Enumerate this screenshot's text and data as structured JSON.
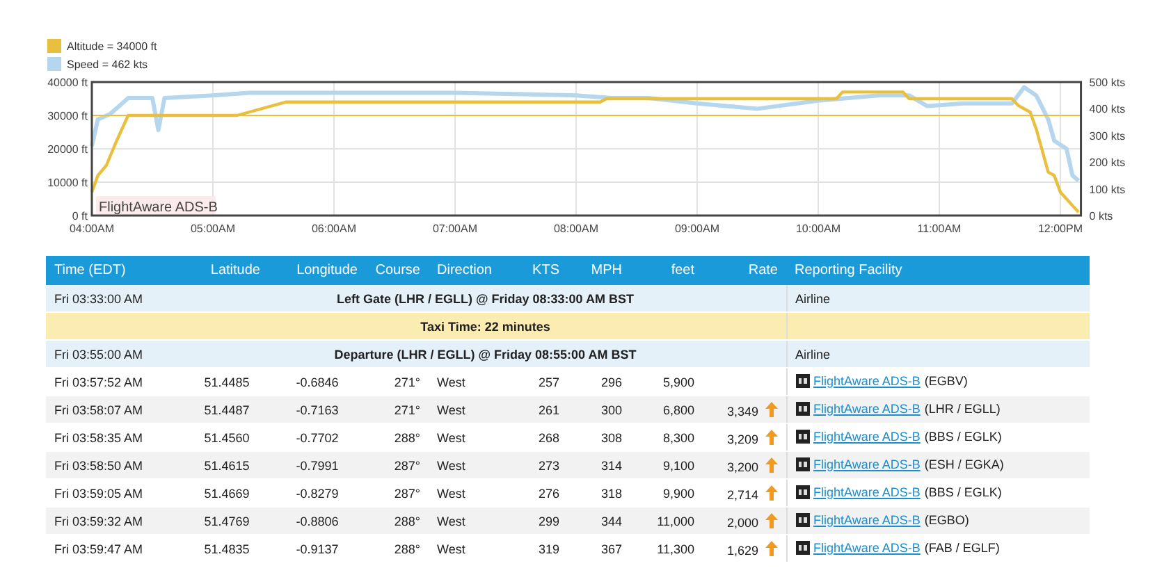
{
  "chart": {
    "legend": [
      {
        "label": "Altitude = 34000 ft",
        "color": "#e8bf3e"
      },
      {
        "label": "Speed = 462 kts",
        "color": "#b6d6ee"
      }
    ],
    "source_label": "FlightAware ADS-B",
    "chart_data": {
      "type": "line",
      "xlim": [
        4,
        12.17
      ],
      "ylim": [
        0,
        40000
      ],
      "y2lim": [
        0,
        500
      ],
      "xticks": [
        {
          "value": 4,
          "label": "04:00AM"
        },
        {
          "value": 5,
          "label": "05:00AM"
        },
        {
          "value": 6,
          "label": "06:00AM"
        },
        {
          "value": 7,
          "label": "07:00AM"
        },
        {
          "value": 8,
          "label": "08:00AM"
        },
        {
          "value": 9,
          "label": "09:00AM"
        },
        {
          "value": 10,
          "label": "10:00AM"
        },
        {
          "value": 11,
          "label": "11:00AM"
        },
        {
          "value": 12,
          "label": "12:00PM"
        }
      ],
      "yticks": [
        {
          "value": 0,
          "label": "0 ft"
        },
        {
          "value": 10000,
          "label": "10000 ft"
        },
        {
          "value": 20000,
          "label": "20000 ft"
        },
        {
          "value": 30000,
          "label": "30000 ft"
        },
        {
          "value": 40000,
          "label": "40000 ft"
        }
      ],
      "y2ticks": [
        {
          "value": 0,
          "label": "0 kts"
        },
        {
          "value": 100,
          "label": "100 kts"
        },
        {
          "value": 200,
          "label": "200 kts"
        },
        {
          "value": 300,
          "label": "300 kts"
        },
        {
          "value": 400,
          "label": "400 kts"
        },
        {
          "value": 500,
          "label": "500 kts"
        }
      ],
      "grid": true,
      "series": [
        {
          "color": "#e8bf3e",
          "x": [
            4,
            12.17
          ],
          "values": [
            30000,
            30000
          ]
        },
        {
          "color": "#e8bf3e",
          "x": [
            4,
            4.05,
            4.12,
            4.2,
            4.3,
            5.2,
            5.6,
            8.2,
            8.25,
            10.15,
            10.2,
            10.7,
            10.75,
            11.6,
            11.65,
            11.75,
            11.8,
            11.9,
            11.95,
            12,
            12.05,
            12.1,
            12.15
          ],
          "values": [
            7000,
            12000,
            15000,
            22000,
            30000,
            30000,
            34000,
            34000,
            35000,
            35000,
            37000,
            37000,
            35000,
            35000,
            33000,
            31000,
            26000,
            13000,
            12000,
            7000,
            5000,
            3000,
            1000
          ]
        },
        {
          "color": "#b6d6ee",
          "axis": "y2",
          "x": [
            4,
            4.05,
            4.15,
            4.2,
            4.3,
            4.5,
            4.55,
            4.6,
            5,
            5.3,
            6,
            7,
            8,
            8.3,
            8.6,
            9,
            9.5,
            10,
            10.5,
            10.75,
            10.9,
            11.2,
            11.6,
            11.7,
            11.8,
            11.9,
            11.95,
            12.05,
            12.1,
            12.15
          ],
          "values": [
            260,
            360,
            380,
            400,
            440,
            440,
            320,
            440,
            450,
            460,
            460,
            460,
            450,
            440,
            440,
            420,
            400,
            430,
            450,
            450,
            410,
            420,
            420,
            480,
            450,
            360,
            280,
            250,
            150,
            130
          ]
        }
      ]
    }
  },
  "table": {
    "columns": [
      "Time (EDT)",
      "Latitude",
      "Longitude",
      "Course",
      "Direction",
      "KTS",
      "MPH",
      "feet",
      "Rate",
      "Reporting Facility"
    ],
    "rows": [
      {
        "kind": "event",
        "time": "Fri 03:33:00 AM",
        "text": "Left Gate (LHR / EGLL) @ Friday 08:33:00 AM BST",
        "facility": "Airline"
      },
      {
        "kind": "taxi",
        "text": "Taxi Time: 22 minutes"
      },
      {
        "kind": "event",
        "time": "Fri 03:55:00 AM",
        "text": "Departure (LHR / EGLL) @ Friday 08:55:00 AM BST",
        "facility": "Airline"
      },
      {
        "kind": "position",
        "time": "Fri 03:57:52 AM",
        "lat": "51.4485",
        "lon": "-0.6846",
        "course": "271°",
        "direction": "West",
        "kts": "257",
        "mph": "296",
        "feet": "5,900",
        "facility_link": "FlightAware ADS-B",
        "facility_suffix": "(EGBV)"
      },
      {
        "kind": "position",
        "time": "Fri 03:58:07 AM",
        "lat": "51.4487",
        "lon": "-0.7163",
        "course": "271°",
        "direction": "West",
        "kts": "261",
        "mph": "300",
        "feet": "6,800",
        "rate": "3,349",
        "climbing": true,
        "facility_link": "FlightAware ADS-B",
        "facility_suffix": "(LHR / EGLL)"
      },
      {
        "kind": "position",
        "time": "Fri 03:58:35 AM",
        "lat": "51.4560",
        "lon": "-0.7702",
        "course": "288°",
        "direction": "West",
        "kts": "268",
        "mph": "308",
        "feet": "8,300",
        "rate": "3,209",
        "climbing": true,
        "facility_link": "FlightAware ADS-B",
        "facility_suffix": "(BBS / EGLK)"
      },
      {
        "kind": "position",
        "time": "Fri 03:58:50 AM",
        "lat": "51.4615",
        "lon": "-0.7991",
        "course": "287°",
        "direction": "West",
        "kts": "273",
        "mph": "314",
        "feet": "9,100",
        "rate": "3,200",
        "climbing": true,
        "facility_link": "FlightAware ADS-B",
        "facility_suffix": "(ESH / EGKA)"
      },
      {
        "kind": "position",
        "time": "Fri 03:59:05 AM",
        "lat": "51.4669",
        "lon": "-0.8279",
        "course": "287°",
        "direction": "West",
        "kts": "276",
        "mph": "318",
        "feet": "9,900",
        "rate": "2,714",
        "climbing": true,
        "facility_link": "FlightAware ADS-B",
        "facility_suffix": "(BBS / EGLK)"
      },
      {
        "kind": "position",
        "time": "Fri 03:59:32 AM",
        "lat": "51.4769",
        "lon": "-0.8806",
        "course": "288°",
        "direction": "West",
        "kts": "299",
        "mph": "344",
        "feet": "11,000",
        "rate": "2,000",
        "climbing": true,
        "facility_link": "FlightAware ADS-B",
        "facility_suffix": "(EGBO)"
      },
      {
        "kind": "position",
        "time": "Fri 03:59:47 AM",
        "lat": "51.4835",
        "lon": "-0.9137",
        "course": "288°",
        "direction": "West",
        "kts": "319",
        "mph": "367",
        "feet": "11,300",
        "rate": "1,629",
        "climbing": true,
        "facility_link": "FlightAware ADS-B",
        "facility_suffix": "(FAB / EGLF)"
      }
    ]
  }
}
